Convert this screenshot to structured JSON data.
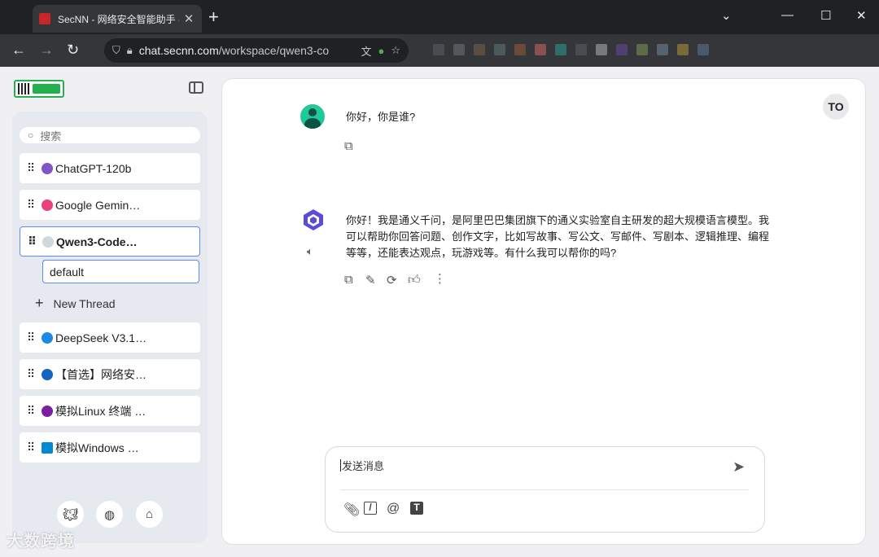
{
  "browser": {
    "tab_title": "SecNN - 网络安全智能助手 - 测",
    "tab_close": "✕",
    "new_tab": "+",
    "url_host": "chat.secnn.com",
    "url_path": "/workspace/qwen3-co",
    "controls": {
      "dropdown": "⌄",
      "minimize": "—",
      "maximize": "☐",
      "close": "✕"
    },
    "nav": {
      "back": "←",
      "forward": "→",
      "reload": "↻"
    }
  },
  "sidebar": {
    "search_placeholder": "搜索",
    "models": [
      {
        "label": "ChatGPT-120b",
        "icon_color": "#7e57c2"
      },
      {
        "label": "Google Gemin…",
        "icon_color": "#ec407a"
      },
      {
        "label": "Qwen3-Code…",
        "icon_color": "#b0bec5"
      },
      {
        "label": "DeepSeek V3.1…",
        "icon_color": "#1e88e5"
      },
      {
        "label": "【首选】网络安…",
        "icon_color": "#1565c0"
      },
      {
        "label": "模拟Linux 终端 …",
        "icon_color": "#7b1fa2"
      },
      {
        "label": "模拟Windows …",
        "icon_color": "#0288d1"
      }
    ],
    "thread": "default",
    "new_thread": "New Thread"
  },
  "chat": {
    "user_message": "你好，你是谁?",
    "bot_message_lines": [
      "你好！我是通义千问，是阿里巴巴集团旗下的通义实验室自主研发的超大规模语言模型。我",
      "可以帮助你回答问题、创作文字，比如写故事、写公文、写邮件、写剧本、逻辑推理、编程",
      "等等，还能表达观点，玩游戏等。有什么我可以帮你的吗?"
    ],
    "user_badge": "TO"
  },
  "composer": {
    "placeholder": "发送消息"
  },
  "watermark": "大数跨境",
  "colors": {
    "accent": "#5b8def",
    "bot_avatar": "#5b4bdb",
    "user_avatar": "#20c997"
  }
}
